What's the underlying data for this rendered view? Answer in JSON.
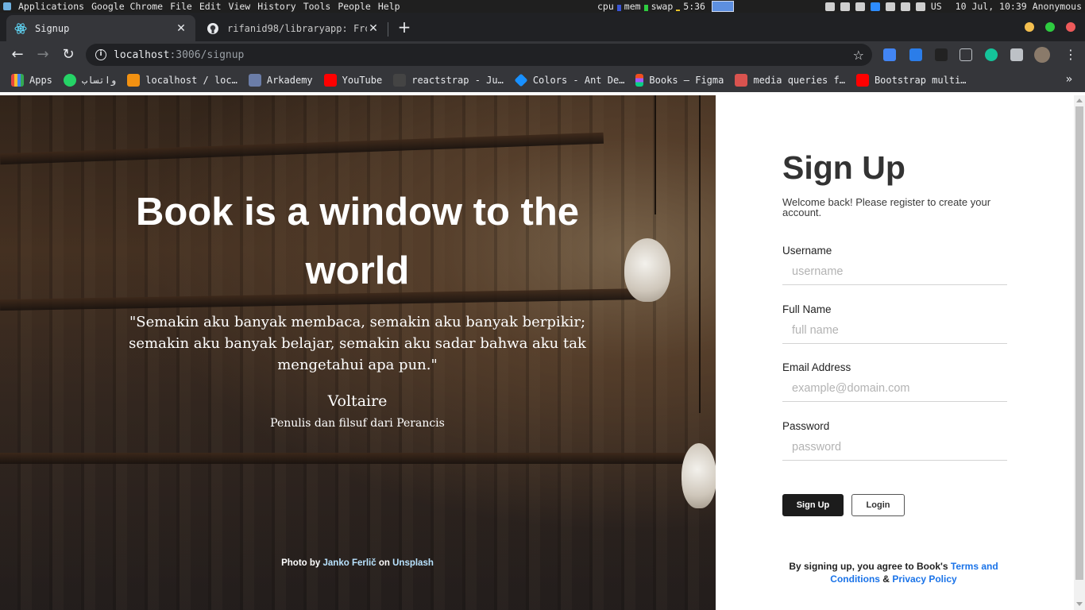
{
  "os_bar": {
    "menu": [
      "Applications",
      "Google Chrome",
      "File",
      "Edit",
      "View",
      "History",
      "Tools",
      "People",
      "Help"
    ],
    "monitors": [
      "cpu",
      "mem",
      "swap",
      "5:36"
    ],
    "keyboard": "US",
    "datetime": "10 Jul, 10:39",
    "user": "Anonymous"
  },
  "tabs": [
    {
      "title": "Signup",
      "active": true
    },
    {
      "title": "rifanid98/libraryapp: Fro",
      "active": false
    }
  ],
  "toolbar": {
    "url_host": "localhost",
    "url_rest": ":3006/signup"
  },
  "bookmarks": [
    {
      "label": "Apps",
      "color": "#e8453c"
    },
    {
      "label": "واتساب",
      "color": "#25d366"
    },
    {
      "label": "localhost / loc…",
      "color": "#f29111"
    },
    {
      "label": "Arkademy",
      "color": "#6b7da8"
    },
    {
      "label": "YouTube",
      "color": "#ff0000"
    },
    {
      "label": "reactstrap - Ju…",
      "color": "#444444"
    },
    {
      "label": "Colors - Ant De…",
      "color": "#1890ff"
    },
    {
      "label": "Books – Figma",
      "color": "#f24e1e"
    },
    {
      "label": "media queries f…",
      "color": "#d9534f"
    },
    {
      "label": "Bootstrap multi…",
      "color": "#ff0000"
    }
  ],
  "hero": {
    "title": "Book is a window to the world",
    "quote": "\"Semakin aku banyak membaca, semakin aku banyak berpikir; semakin aku banyak belajar, semakin aku sadar bahwa aku tak mengetahui apa pun.\"",
    "author": "Voltaire",
    "author_desc": "Penulis dan filsuf dari Perancis",
    "credit_prefix": "Photo by",
    "credit_author": "Janko Ferlič",
    "credit_mid": "on",
    "credit_site": "Unsplash"
  },
  "form": {
    "title": "Sign Up",
    "subtitle": "Welcome back! Please register to create your account.",
    "fields": [
      {
        "label": "Username",
        "placeholder": "username",
        "value": ""
      },
      {
        "label": "Full Name",
        "placeholder": "full name",
        "value": ""
      },
      {
        "label": "Email Address",
        "placeholder": "example@domain.com",
        "value": ""
      },
      {
        "label": "Password",
        "placeholder": "password",
        "value": ""
      }
    ],
    "signup_label": "Sign Up",
    "login_label": "Login",
    "terms_prefix": "By signing up, you agree to Book's",
    "terms_link": "Terms and Conditions",
    "terms_and": "&",
    "privacy_link": "Privacy Policy"
  },
  "colors": {
    "primary_button": "#1c1c1c",
    "link": "#1a73e8",
    "credit_link": "#b9e3ff"
  }
}
